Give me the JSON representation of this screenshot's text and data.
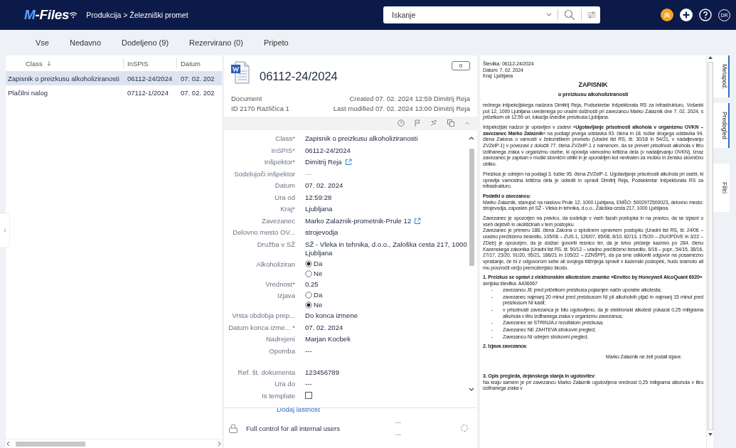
{
  "header": {
    "logo": "M-Files",
    "breadcrumb": "Produkcija > Železniški promet",
    "search": {
      "placeholder": "Iskanje"
    },
    "avatar": "DR"
  },
  "tabs": [
    {
      "label": "Vse"
    },
    {
      "label": "Nedavno"
    },
    {
      "label": "Dodeljeno (9)"
    },
    {
      "label": "Rezervirano (0)"
    },
    {
      "label": "Pripeto"
    }
  ],
  "list": {
    "columns": [
      "Class",
      "InSPIS",
      "Datum"
    ],
    "rows": [
      {
        "cells": [
          "Zapisnik o preizkusu alkoholiziranosti",
          "06112-24/2024",
          "07. 02. 202"
        ],
        "selected": true
      },
      {
        "cells": [
          "Plačilni nalog",
          "07112-1/2024",
          "07. 02. 202"
        ],
        "selected": false
      }
    ]
  },
  "object": {
    "title": "06112-24/2024",
    "comments": "0",
    "type": "Document",
    "id_version": "ID 2170  Različica 1",
    "created": "Created 07. 02. 2024 12:59 Dimitrij Reja",
    "modified": "Last modified 07. 02. 2024 13:00 Dimitrij Reja",
    "properties": [
      {
        "label": "Class*",
        "kind": "text",
        "value": "Zapisnik o preizkusu alkoholiziranosti"
      },
      {
        "label": "InSPIS*",
        "kind": "text",
        "value": "06112-24/2024"
      },
      {
        "label": "Inšpektor*",
        "kind": "link",
        "value": "Dimitrij Reja"
      },
      {
        "label": "Sodelujoči inšpektor",
        "kind": "empty",
        "value": "---"
      },
      {
        "label": "Datum",
        "kind": "text",
        "value": "07. 02. 2024"
      },
      {
        "label": "Ura od",
        "kind": "text",
        "value": "12:59:28"
      },
      {
        "label": "Kraj*",
        "kind": "text",
        "value": "Ljubljana"
      },
      {
        "label": "Zavezanec",
        "kind": "link",
        "value": "Marko Zalaznik-prometnik-Prule 12"
      },
      {
        "label": "Delovno mesto OV...",
        "kind": "text",
        "value": "strojevodja"
      },
      {
        "label": "Družba v SŽ",
        "kind": "text",
        "value": "SŽ - Vleka in tehnika, d.o.o., Zaloška cesta 217, 1000 Ljubljana"
      },
      {
        "label": "Alkoholiziran",
        "kind": "radio",
        "options": [
          {
            "label": "Da",
            "selected": true
          },
          {
            "label": "Ne",
            "selected": false
          }
        ]
      },
      {
        "label": "Vrednost*",
        "kind": "text",
        "value": "0.25"
      },
      {
        "label": "Izjava",
        "kind": "radio",
        "options": [
          {
            "label": "Da",
            "selected": false
          },
          {
            "label": "Ne",
            "selected": true
          }
        ]
      },
      {
        "label": "Vrsta obdobja prep...",
        "kind": "text",
        "value": "Do konca izmene"
      },
      {
        "label": "Datum konca izme... *",
        "kind": "text",
        "value": "07. 02. 2024"
      },
      {
        "label": "Nadrejeni",
        "kind": "text",
        "value": "Marjan Kocbek"
      },
      {
        "label": "Opomba",
        "kind": "multiline",
        "value": "---"
      },
      {
        "label": "Ref. št. dokumenta",
        "kind": "text",
        "value": "123456789"
      },
      {
        "label": "Ura do",
        "kind": "text",
        "value": "---"
      },
      {
        "label": "Is template",
        "kind": "checkbox",
        "checked": false
      }
    ],
    "add_property": "Dodaj lastnost",
    "permissions": {
      "label": "Full control for all internal users",
      "line_1": "---",
      "line_2": "---"
    }
  },
  "preview": {
    "blocks": [
      {
        "kind": "line",
        "text": "Številka: 06112-24/2024"
      },
      {
        "kind": "line",
        "text": "Datum: 7. 02. 2024"
      },
      {
        "kind": "line",
        "text": "Kraj: Ljubljana"
      },
      {
        "kind": "title",
        "text": "ZAPISNIK"
      },
      {
        "kind": "subtitle",
        "text": "o preizkusu alkoholiziranosti"
      },
      {
        "kind": "para",
        "text": "rednega inšpekcijskega nadzora Dimitrij Reja, Podsekretar Inšpektorata RS za infrastrukturo, Vošanki pot 12, 1000 Ljubljana uvedenega po uradni dolžnosti pri zavezancu Marko Zalaznik dne 7. 02. 2024, s pričetkom ob 12:59 uri, lokacija izvedbe preizkusa Ljubljana."
      },
      {
        "kind": "para",
        "text": "Inšpekcijski nadzor je opravljen v zadevi »**Ugotavljanje prisotnosti alkohola v organizmu OVKN – zavezanec Marko Zalaznik**« na podlagi prvega odstavka 93. člena in 18. točke drugega odstavka 94. člena Zakona o varnosti v železniškem prometu (Uradni list RS, št. 30/18 in 54/21, v nadaljevanju ZVZelP-1) v povezavi z določili 77. člena ZVZelP-1 z namenom, da se preveri prisotnost alkohola v litru izdihanega zraka v organizmu osebe, ki opravlja varnostno kritična dela (v nadaljevanju OVKN). Izraz zavezanec je zapisan v moški slovnični obliki in je uporabljen kot nevtralen za moško in žensko slovnično obliko."
      },
      {
        "kind": "para",
        "text": "Preizkus je odrejen na podlagi 3. točke 95. člena ZVZelP-1. Ugotavljanje prisotnosti alkohola pri osebi, ki opravlja varnostna kritična dela je odredil in opravil Dimitrij Reja, Podsekretar Inšpektorata RS za infrastrukturo."
      },
      {
        "kind": "line",
        "text": "**Podatki o zavezancu**:"
      },
      {
        "kind": "para",
        "text": "Marko Zalaznik, stanujoč na naslovu Prule 12, 1000 Ljubljana, EMŠO: 5002972500023, delovno mesto: strojevodja, zaposlen pri SŽ - Vleka in tehnika, d.o.o., Zaloška cesta 217, 1000 Ljubljana."
      },
      {
        "kind": "line",
        "text": "Zavezanec je opozorjen na pravico, da sodeluje v vseh fazah postopka in na pravico, da se izjasni o vseh dejstvih in okoliščinah v tem postopku."
      },
      {
        "kind": "para",
        "text": "Zavezanec je primeru 188. člena Zakona o splošnem upravnem postopku (Uradni list RS, št. 24/06 – uradno prečiščeno besedilo, 105/06 – ZUS-1, 126/07, 65/08, 8/10, 82/13, 175/20 – ZIUOPDVE in 3/22 – ZDeb) je opozorjen, da je dolžan govoriti resnico ter, da je krivo pričanje kaznivo po 284. členu Kazenskega zakonika (Uradni list RS, št. 50/12 – uradno prečiščeno besedilo, 6/16 – popr., 54/15, 38/16, 27/17, 23/20, 91/20, 95/21, 186/21 in 105/22 – ZZNŠPP), da pa sme odkloniti odgovor na posamezno vprašanje, če bi z odgovorom sebe ali svojega bližnjega spravil v kazenski postopek, hudo sramoto ali mu povzročil večjo premoženjsko škodo."
      },
      {
        "kind": "line",
        "text": "**1. Preizkus se opravi z elektronskim alkotestom znamke »Envitec by Honeywell AlcoQuant 6020«**"
      },
      {
        "kind": "line",
        "text": "serijska številka: A436067"
      },
      {
        "kind": "bullets",
        "items": [
          {
            "marker": "-",
            "text": "zavezancu JE pred pričetkom preizkusa pojasnjen način uporabe alkotesta;"
          },
          {
            "marker": "-",
            "text": "zavezanec najmanj 20 minut pred preizkusom NI pil alkoholnih pijač in najmanj 15 minut pred preizkusom NI kadil;"
          },
          {
            "marker": "-",
            "text": "v prisotnosti zavezanca je bilo ugotovljeno, da je elektronski alkotest pokazal 0,25 miligrama alkohola v litru izdihanega zraka v organizmu zavezanca;"
          },
          {
            "marker": "-",
            "text": "Zavezanec se STRINJA z rezultatom preizkusa;"
          },
          {
            "marker": "-",
            "text": "Zavezanec NE ZAHTEVA strokovni pregled;"
          },
          {
            "marker": "-",
            "text": "Zavezancu NI odrejen strokovni pregled;"
          }
        ]
      },
      {
        "kind": "line",
        "text": "**2. Izjava zavezanca**:"
      },
      {
        "kind": "right",
        "text": "Marko Zalaznik ne želi podati izjave."
      },
      {
        "kind": "line",
        "text": "**3. Opis pregleda, dejanskega stanja in ugotovitev**:"
      },
      {
        "kind": "line",
        "text": "Na kraju samem je pri zavezancu Marko Zalaznik ugotovljena vrednost 0,25 miligrama alkohola v litru izdihanega zraka v"
      }
    ]
  },
  "side_tabs": [
    {
      "label": "Metapod.",
      "selected": true
    },
    {
      "label": "Predogled",
      "selected": true
    },
    {
      "label": "Filtri",
      "selected": false
    }
  ]
}
